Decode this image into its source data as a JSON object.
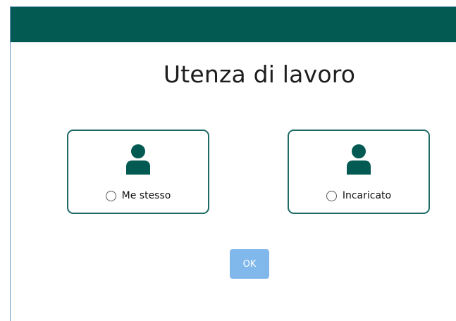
{
  "modal": {
    "title": "Utenza di lavoro",
    "header_color": "#025a53"
  },
  "options": [
    {
      "label": "Me stesso",
      "icon": "user-icon",
      "selected": false
    },
    {
      "label": "Incaricato",
      "icon": "user-icon",
      "selected": false
    }
  ],
  "ok_button": {
    "label": "OK",
    "enabled": false,
    "color": "#80b8ec"
  }
}
